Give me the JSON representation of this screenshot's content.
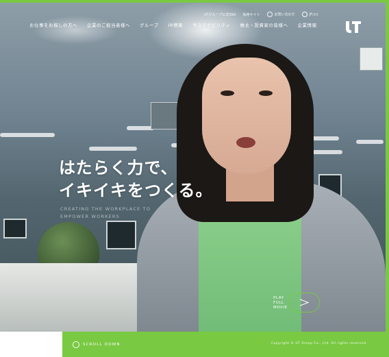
{
  "brand": {
    "logo_text": "UT",
    "accent_color": "#7ac943"
  },
  "nav": {
    "items": [
      {
        "label": "お仕事をお探しの方へ"
      },
      {
        "label": "企業のご担当者様へ"
      },
      {
        "label": "グループ"
      },
      {
        "label": "IR情報"
      },
      {
        "label": "サステナビリティ"
      },
      {
        "label": "株主・投資家の皆様へ"
      },
      {
        "label": "企業情報"
      }
    ]
  },
  "utility": {
    "items": [
      {
        "label": "UTグループ公式SNS"
      },
      {
        "label": "採用サイト"
      },
      {
        "label": "お問い合わせ"
      }
    ],
    "lang_current": "JP",
    "lang_separator": "/",
    "lang_other": "EN"
  },
  "hero": {
    "headline_line1": "はたらく力で、",
    "headline_line2": "イキイキをつくる。",
    "sub_line1": "CREATING THE WORKPLACE TO",
    "sub_line2": "EMPOWER WORKERS"
  },
  "play_movie": {
    "line1": "PLAY",
    "line2": "FULL",
    "line3": "MOVIE"
  },
  "footer": {
    "scroll_label": "SCROLL DOWN",
    "copyright": "Copyright © UT Group Co., Ltd. All rights reserved."
  }
}
